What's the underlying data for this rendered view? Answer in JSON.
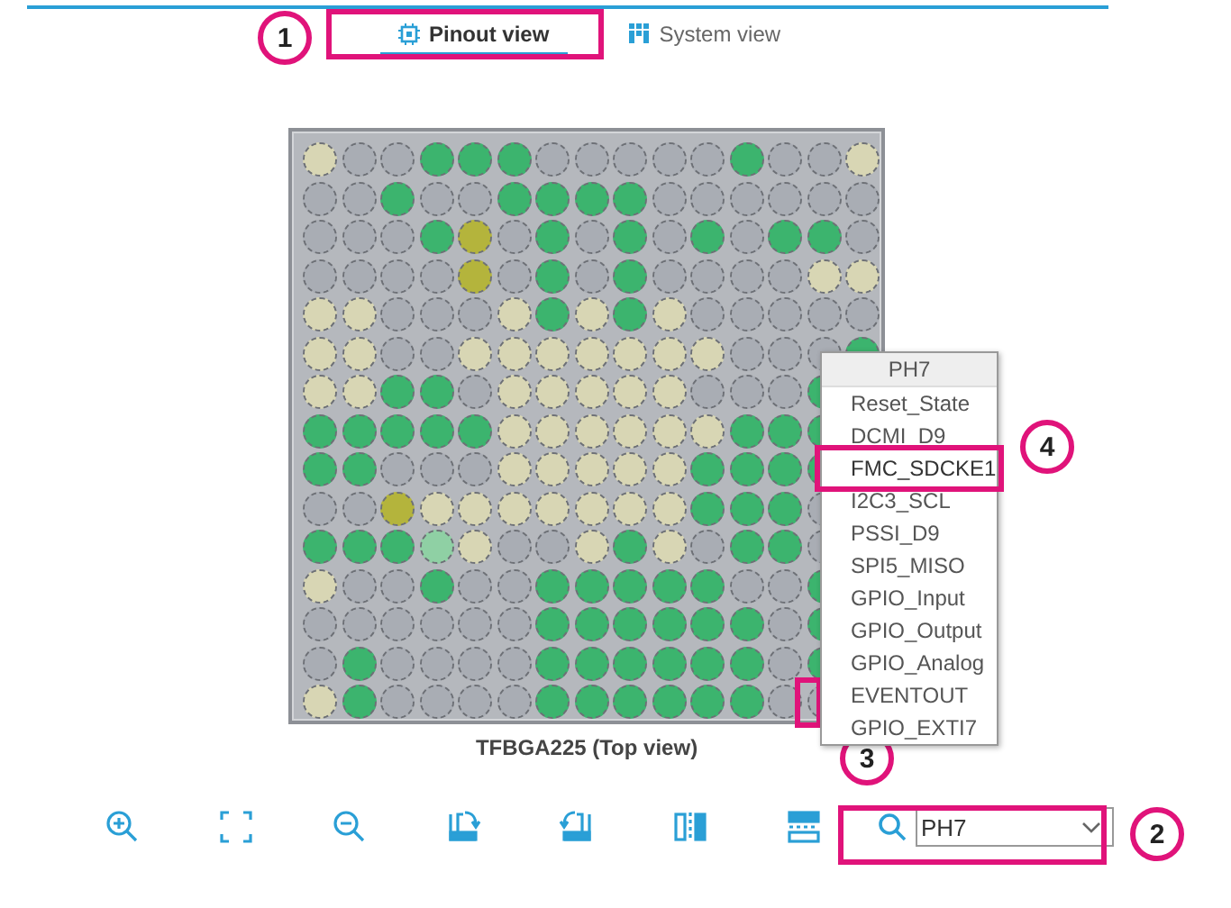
{
  "tabs": [
    {
      "label": "Pinout view",
      "selected": true
    },
    {
      "label": "System view",
      "selected": false
    }
  ],
  "package": {
    "label": "TFBGA225 (Top view)",
    "rows": [
      {
        "pins": [
          {
            "color": "#d8d6b4"
          },
          {
            "color": "#a9adb4"
          },
          {
            "color": "#a9adb4"
          },
          {
            "color": "#3cb46e"
          },
          {
            "color": "#3cb46e"
          },
          {
            "color": "#3cb46e"
          },
          {
            "color": "#a9adb4"
          },
          {
            "color": "#a9adb4"
          },
          {
            "color": "#a9adb4"
          },
          {
            "color": "#a9adb4"
          },
          {
            "color": "#a9adb4"
          },
          {
            "color": "#3cb46e"
          },
          {
            "color": "#a9adb4"
          },
          {
            "color": "#a9adb4"
          },
          {
            "color": "#d8d6b4"
          }
        ]
      },
      {
        "pins": [
          {
            "color": "#a9adb4"
          },
          {
            "color": "#a9adb4"
          },
          {
            "color": "#3cb46e"
          },
          {
            "color": "#a9adb4"
          },
          {
            "color": "#a9adb4"
          },
          {
            "color": "#3cb46e"
          },
          {
            "color": "#3cb46e"
          },
          {
            "color": "#3cb46e"
          },
          {
            "color": "#3cb46e"
          },
          {
            "color": "#a9adb4"
          },
          {
            "color": "#a9adb4"
          },
          {
            "color": "#a9adb4"
          },
          {
            "color": "#a9adb4"
          },
          {
            "color": "#a9adb4"
          },
          {
            "color": "#a9adb4"
          }
        ]
      },
      {
        "pins": [
          {
            "color": "#a9adb4"
          },
          {
            "color": "#a9adb4"
          },
          {
            "color": "#a9adb4"
          },
          {
            "color": "#3cb46e"
          },
          {
            "color": "#b4b43c"
          },
          {
            "color": "#a9adb4"
          },
          {
            "color": "#3cb46e"
          },
          {
            "color": "#a9adb4"
          },
          {
            "color": "#3cb46e"
          },
          {
            "color": "#a9adb4"
          },
          {
            "color": "#3cb46e"
          },
          {
            "color": "#a9adb4"
          },
          {
            "color": "#3cb46e"
          },
          {
            "color": "#3cb46e"
          },
          {
            "color": "#a9adb4"
          }
        ]
      },
      {
        "pins": [
          {
            "color": "#a9adb4"
          },
          {
            "color": "#a9adb4"
          },
          {
            "color": "#a9adb4"
          },
          {
            "color": "#a9adb4"
          },
          {
            "color": "#b4b43c"
          },
          {
            "color": "#a9adb4"
          },
          {
            "color": "#3cb46e"
          },
          {
            "color": "#a9adb4"
          },
          {
            "color": "#3cb46e"
          },
          {
            "color": "#a9adb4"
          },
          {
            "color": "#a9adb4"
          },
          {
            "color": "#a9adb4"
          },
          {
            "color": "#a9adb4"
          },
          {
            "color": "#d8d6b4"
          },
          {
            "color": "#d8d6b4"
          }
        ]
      },
      {
        "pins": [
          {
            "color": "#d8d6b4"
          },
          {
            "color": "#d8d6b4"
          },
          {
            "color": "#a9adb4"
          },
          {
            "color": "#a9adb4"
          },
          {
            "color": "#a9adb4"
          },
          {
            "color": "#d8d6b4"
          },
          {
            "color": "#3cb46e"
          },
          {
            "color": "#d8d6b4"
          },
          {
            "color": "#3cb46e"
          },
          {
            "color": "#d8d6b4"
          },
          {
            "color": "#a9adb4"
          },
          {
            "color": "#a9adb4"
          },
          {
            "color": "#a9adb4"
          },
          {
            "color": "#a9adb4"
          },
          {
            "color": "#a9adb4"
          }
        ]
      },
      {
        "pins": [
          {
            "color": "#d8d6b4"
          },
          {
            "color": "#d8d6b4"
          },
          {
            "color": "#a9adb4"
          },
          {
            "color": "#a9adb4"
          },
          {
            "color": "#d8d6b4"
          },
          {
            "color": "#d8d6b4"
          },
          {
            "color": "#d8d6b4"
          },
          {
            "color": "#d8d6b4"
          },
          {
            "color": "#d8d6b4"
          },
          {
            "color": "#d8d6b4"
          },
          {
            "color": "#d8d6b4"
          },
          {
            "color": "#a9adb4"
          },
          {
            "color": "#a9adb4"
          },
          {
            "color": "#a9adb4"
          },
          {
            "color": "#3cb46e"
          }
        ]
      },
      {
        "pins": [
          {
            "color": "#d8d6b4"
          },
          {
            "color": "#d8d6b4"
          },
          {
            "color": "#3cb46e"
          },
          {
            "color": "#3cb46e"
          },
          {
            "color": "#a9adb4"
          },
          {
            "color": "#d8d6b4"
          },
          {
            "color": "#d8d6b4"
          },
          {
            "color": "#d8d6b4"
          },
          {
            "color": "#d8d6b4"
          },
          {
            "color": "#d8d6b4"
          },
          {
            "color": "#a9adb4"
          },
          {
            "color": "#a9adb4"
          },
          {
            "color": "#a9adb4"
          },
          {
            "color": "#3cb46e"
          }
        ]
      },
      {
        "pins": [
          {
            "color": "#3cb46e"
          },
          {
            "color": "#3cb46e"
          },
          {
            "color": "#3cb46e"
          },
          {
            "color": "#3cb46e"
          },
          {
            "color": "#3cb46e"
          },
          {
            "color": "#d8d6b4"
          },
          {
            "color": "#d8d6b4"
          },
          {
            "color": "#d8d6b4"
          },
          {
            "color": "#d8d6b4"
          },
          {
            "color": "#d8d6b4"
          },
          {
            "color": "#d8d6b4"
          },
          {
            "color": "#3cb46e"
          },
          {
            "color": "#3cb46e"
          },
          {
            "color": "#3cb46e"
          }
        ]
      },
      {
        "pins": [
          {
            "color": "#3cb46e"
          },
          {
            "color": "#3cb46e"
          },
          {
            "color": "#a9adb4"
          },
          {
            "color": "#a9adb4"
          },
          {
            "color": "#a9adb4"
          },
          {
            "color": "#d8d6b4"
          },
          {
            "color": "#d8d6b4"
          },
          {
            "color": "#d8d6b4"
          },
          {
            "color": "#d8d6b4"
          },
          {
            "color": "#d8d6b4"
          },
          {
            "color": "#3cb46e"
          },
          {
            "color": "#3cb46e"
          },
          {
            "color": "#3cb46e"
          },
          {
            "color": "#3cb46e"
          }
        ]
      },
      {
        "pins": [
          {
            "color": "#a9adb4"
          },
          {
            "color": "#a9adb4"
          },
          {
            "color": "#b4b43c"
          },
          {
            "color": "#d8d6b4"
          },
          {
            "color": "#d8d6b4"
          },
          {
            "color": "#d8d6b4"
          },
          {
            "color": "#d8d6b4"
          },
          {
            "color": "#d8d6b4"
          },
          {
            "color": "#d8d6b4"
          },
          {
            "color": "#d8d6b4"
          },
          {
            "color": "#3cb46e"
          },
          {
            "color": "#3cb46e"
          },
          {
            "color": "#3cb46e"
          },
          {
            "color": "#a9adb4"
          }
        ]
      },
      {
        "pins": [
          {
            "color": "#3cb46e"
          },
          {
            "color": "#3cb46e"
          },
          {
            "color": "#3cb46e"
          },
          {
            "color": "#8fd0a4"
          },
          {
            "color": "#d8d6b4"
          },
          {
            "color": "#a9adb4"
          },
          {
            "color": "#a9adb4"
          },
          {
            "color": "#d8d6b4"
          },
          {
            "color": "#3cb46e"
          },
          {
            "color": "#d8d6b4"
          },
          {
            "color": "#a9adb4"
          },
          {
            "color": "#3cb46e"
          },
          {
            "color": "#3cb46e"
          },
          {
            "color": "#a9adb4"
          }
        ]
      },
      {
        "pins": [
          {
            "color": "#d8d6b4"
          },
          {
            "color": "#a9adb4"
          },
          {
            "color": "#a9adb4"
          },
          {
            "color": "#3cb46e"
          },
          {
            "color": "#a9adb4"
          },
          {
            "color": "#a9adb4"
          },
          {
            "color": "#3cb46e"
          },
          {
            "color": "#3cb46e"
          },
          {
            "color": "#3cb46e"
          },
          {
            "color": "#3cb46e"
          },
          {
            "color": "#3cb46e"
          },
          {
            "color": "#a9adb4"
          },
          {
            "color": "#a9adb4"
          },
          {
            "color": "#3cb46e"
          }
        ]
      },
      {
        "pins": [
          {
            "color": "#a9adb4"
          },
          {
            "color": "#a9adb4"
          },
          {
            "color": "#a9adb4"
          },
          {
            "color": "#a9adb4"
          },
          {
            "color": "#a9adb4"
          },
          {
            "color": "#a9adb4"
          },
          {
            "color": "#3cb46e"
          },
          {
            "color": "#3cb46e"
          },
          {
            "color": "#3cb46e"
          },
          {
            "color": "#3cb46e"
          },
          {
            "color": "#3cb46e"
          },
          {
            "color": "#3cb46e"
          },
          {
            "color": "#a9adb4"
          },
          {
            "color": "#3cb46e"
          }
        ]
      },
      {
        "pins": [
          {
            "color": "#a9adb4"
          },
          {
            "color": "#3cb46e"
          },
          {
            "color": "#a9adb4"
          },
          {
            "color": "#a9adb4"
          },
          {
            "color": "#a9adb4"
          },
          {
            "color": "#a9adb4"
          },
          {
            "color": "#3cb46e"
          },
          {
            "color": "#3cb46e"
          },
          {
            "color": "#3cb46e"
          },
          {
            "color": "#3cb46e"
          },
          {
            "color": "#3cb46e"
          },
          {
            "color": "#3cb46e"
          },
          {
            "color": "#a9adb4"
          },
          {
            "color": "#3cb46e"
          }
        ]
      },
      {
        "pins": [
          {
            "color": "#d8d6b4"
          },
          {
            "color": "#3cb46e"
          },
          {
            "color": "#a9adb4"
          },
          {
            "color": "#a9adb4"
          },
          {
            "color": "#a9adb4"
          },
          {
            "color": "#a9adb4"
          },
          {
            "color": "#3cb46e"
          },
          {
            "color": "#3cb46e"
          },
          {
            "color": "#3cb46e"
          },
          {
            "color": "#3cb46e"
          },
          {
            "color": "#3cb46e"
          },
          {
            "color": "#3cb46e"
          },
          {
            "color": "#a9adb4"
          },
          {
            "color": "#a9adb4"
          }
        ]
      }
    ]
  },
  "pin_menu": {
    "title": "PH7",
    "items": [
      {
        "label": "Reset_State",
        "selected": false
      },
      {
        "label": "DCMI_D9",
        "selected": false
      },
      {
        "label": "FMC_SDCKE1",
        "selected": true
      },
      {
        "label": "I2C3_SCL",
        "selected": false
      },
      {
        "label": "PSSI_D9",
        "selected": false
      },
      {
        "label": "SPI5_MISO",
        "selected": false
      },
      {
        "label": "GPIO_Input",
        "selected": false
      },
      {
        "label": "GPIO_Output",
        "selected": false
      },
      {
        "label": "GPIO_Analog",
        "selected": false
      },
      {
        "label": "EVENTOUT",
        "selected": false
      },
      {
        "label": "GPIO_EXTI7",
        "selected": false
      }
    ]
  },
  "toolbar": [
    {
      "kind": "zoom-in"
    },
    {
      "kind": "fit"
    },
    {
      "kind": "zoom-out"
    },
    {
      "kind": "rotate-right"
    },
    {
      "kind": "rotate-left"
    },
    {
      "kind": "flip-vertical"
    },
    {
      "kind": "flip-horizontal"
    }
  ],
  "search": {
    "value": "PH7"
  },
  "annotations": [
    {
      "number": "1",
      "kind": "tab"
    },
    {
      "number": "2",
      "kind": "search"
    },
    {
      "number": "3",
      "kind": "pin"
    },
    {
      "number": "4",
      "kind": "menu"
    }
  ]
}
